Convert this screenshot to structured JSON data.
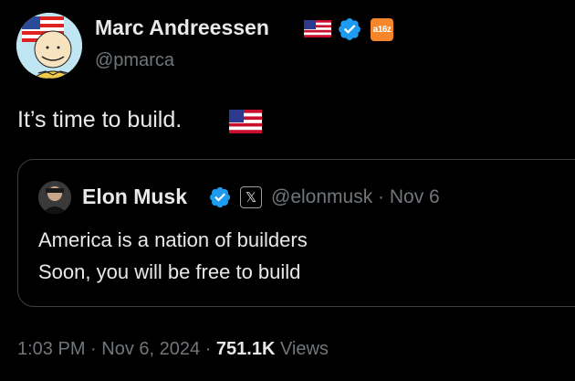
{
  "author": {
    "name": "Marc Andreessen",
    "handle": "@pmarca",
    "affiliate_badge": "a16z"
  },
  "tweet": {
    "text": "It’s time to build."
  },
  "quote": {
    "name": "Elon Musk",
    "x_badge": "𝕏",
    "meta": "@elonmusk · Nov 6",
    "line1": "America is a nation of builders",
    "line2": "Soon, you will be free to build"
  },
  "footer": {
    "timestamp": "1:03 PM · Nov 6, 2024 · ",
    "views_count": "751.1K",
    "views_label": " Views"
  },
  "colors": {
    "background": "#000000",
    "primary_text": "#e7e9ea",
    "secondary_text": "#71767b",
    "verified_blue": "#1d9bf0",
    "affiliate_orange": "#f5872a",
    "border": "#3a3f44"
  }
}
